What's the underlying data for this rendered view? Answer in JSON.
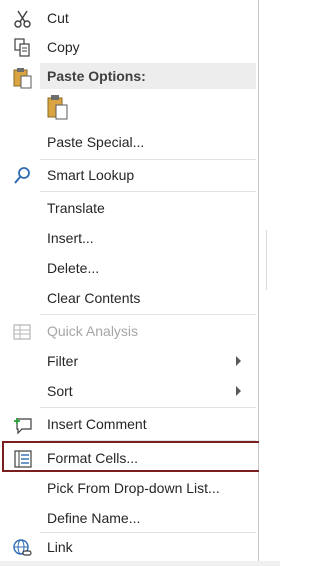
{
  "menu": {
    "items": [
      {
        "label": "Cut",
        "icon": "scissors-icon"
      },
      {
        "label": "Copy",
        "icon": "copy-icon"
      },
      {
        "label": "Paste Options:",
        "icon": "clipboard-icon"
      },
      {
        "label": "Paste Special..."
      },
      {
        "label": "Smart Lookup",
        "icon": "search-icon"
      },
      {
        "label": "Translate"
      },
      {
        "label": "Insert..."
      },
      {
        "label": "Delete..."
      },
      {
        "label": "Clear Contents"
      },
      {
        "label": "Quick Analysis",
        "icon": "quick-analysis-icon",
        "disabled": true
      },
      {
        "label": "Filter",
        "submenu": true
      },
      {
        "label": "Sort",
        "submenu": true
      },
      {
        "label": "Insert Comment",
        "icon": "comment-icon"
      },
      {
        "label": "Format Cells...",
        "icon": "format-cells-icon",
        "highlighted": true
      },
      {
        "label": "Pick From Drop-down List..."
      },
      {
        "label": "Define Name..."
      },
      {
        "label": "Link",
        "icon": "link-icon"
      }
    ]
  },
  "colors": {
    "highlight_border": "#7a1f1f",
    "header_bg": "#ededed",
    "disabled_text": "#a6a6a6"
  }
}
